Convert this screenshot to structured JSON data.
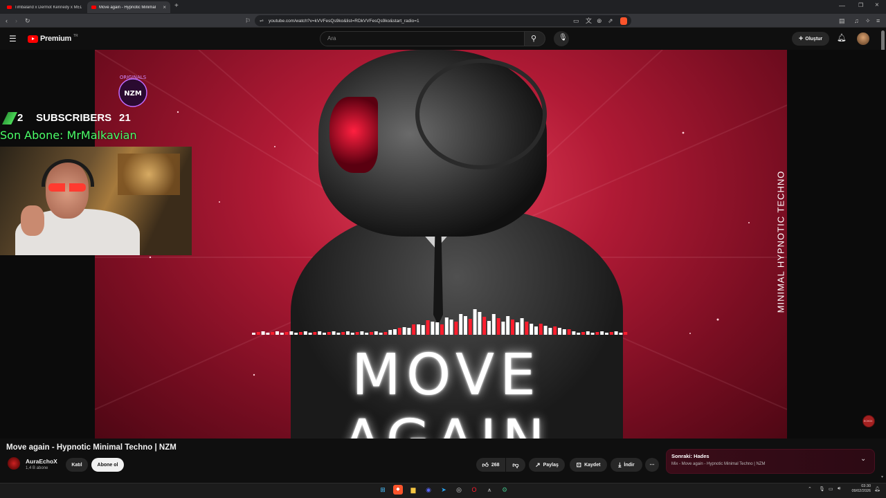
{
  "browser": {
    "tabs": [
      {
        "label": "Timbaland x Dermot Kennedy x MED",
        "active": false
      },
      {
        "label": "Move again - Hypnotic Minimal",
        "active": true
      }
    ],
    "new_tab": "+",
    "url": "youtube.com/watch?v=kVVFesQs9ko&list=RDkVVFesQs9ko&start_radio=1"
  },
  "youtube": {
    "logo_text": "Premium",
    "logo_region": "TR",
    "search_placeholder": "Ara",
    "create_label": "Oluştur"
  },
  "video": {
    "overlay": {
      "logo_top": "ORIGINALS",
      "logo_main": "NZM",
      "subs_left": "2",
      "subs_label": "SUBSCRIBERS",
      "subs_right": "21",
      "last_subscriber": "Son Abone: MrMalkavian"
    },
    "artwork_title": "MOVE AGAIN",
    "side_text": "MINIMAL HYPNOTIC TECHNO",
    "corner_logo": "ECHOX"
  },
  "info": {
    "title": "Move again - Hypnotic Minimal Techno | NZM",
    "channel_name": "AuraEchoX",
    "channel_subs": "1,4 B abone",
    "join_label": "Katıl",
    "subscribe_label": "Abone ol",
    "like_count": "268",
    "share_label": "Paylaş",
    "save_label": "Kaydet",
    "download_label": "İndir",
    "more_label": "⋯"
  },
  "up_next": {
    "label": "Sonraki: Hades",
    "subtitle": "Mix - Move again - Hypnotic Minimal Techno | NZM"
  },
  "taskbar": {
    "time": "03:30",
    "date": "09/02/2026"
  },
  "colors": {
    "youtube_red": "#ff0000",
    "artwork_red": "#b01a35",
    "last_sub_green": "#4cff6a",
    "upnext_bg": "#3a0c18"
  }
}
